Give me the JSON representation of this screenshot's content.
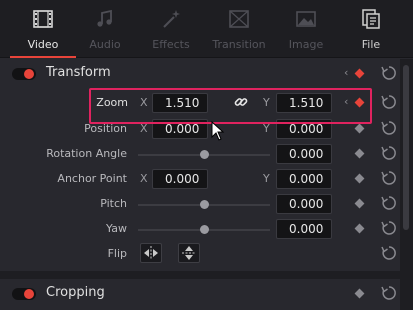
{
  "tabs": [
    {
      "label": "Video",
      "icon": "film-icon",
      "active": true
    },
    {
      "label": "Audio",
      "icon": "music-note-icon",
      "active": false
    },
    {
      "label": "Effects",
      "icon": "magic-wand-icon",
      "active": false
    },
    {
      "label": "Transition",
      "icon": "transition-icon",
      "active": false
    },
    {
      "label": "Image",
      "icon": "image-icon",
      "active": false
    },
    {
      "label": "File",
      "icon": "file-icon",
      "active": false
    }
  ],
  "transform": {
    "title": "Transform",
    "zoom": {
      "label": "Zoom",
      "x_axis": "X",
      "y_axis": "Y",
      "x": "1.510",
      "y": "1.510"
    },
    "position": {
      "label": "Position",
      "x_axis": "X",
      "y_axis": "Y",
      "x": "0.000",
      "y": "0.000"
    },
    "rotation": {
      "label": "Rotation Angle",
      "value": "0.000"
    },
    "anchor": {
      "label": "Anchor Point",
      "x_axis": "X",
      "y_axis": "Y",
      "x": "0.000",
      "y": "0.000"
    },
    "pitch": {
      "label": "Pitch",
      "value": "0.000"
    },
    "yaw": {
      "label": "Yaw",
      "value": "0.000"
    },
    "flip": {
      "label": "Flip"
    }
  },
  "cropping": {
    "title": "Cropping"
  },
  "keyframe_nav": "‹",
  "colors": {
    "accent": "#e8443a",
    "highlight": "#e0235f",
    "panel": "#28282e",
    "field": "#141416"
  }
}
